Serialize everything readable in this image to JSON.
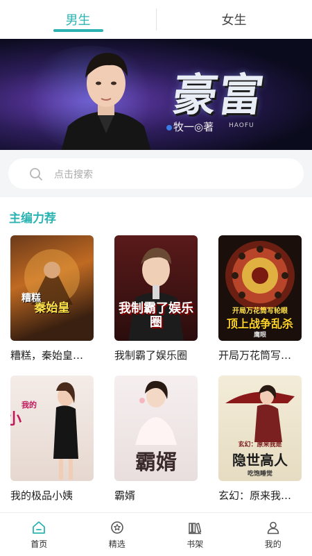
{
  "top_tabs": [
    {
      "label": "男生",
      "active": true
    },
    {
      "label": "女生",
      "active": false
    }
  ],
  "banner": {
    "title": "豪富",
    "author": "牧一◎著",
    "pinyin": "HAOFU"
  },
  "search": {
    "placeholder": "点击搜索"
  },
  "section": {
    "title": "主编力荐"
  },
  "books": [
    {
      "title": "糟糕，秦始皇…",
      "cover_text": "秦始皇",
      "cover_sub": "糟糕"
    },
    {
      "title": "我制霸了娱乐圈",
      "cover_text": "我制霸了娱乐圈"
    },
    {
      "title": "开局万花筒写…",
      "cover_text": "顶上战争乱杀",
      "cover_sub": "开局万花筒写轮眼",
      "cover_author": "鹰眼"
    },
    {
      "title": "我的极品小姨",
      "cover_text": "极品小姨",
      "cover_sub": "我的"
    },
    {
      "title": "霸婿",
      "cover_text": "霸婿"
    },
    {
      "title": "玄幻：原来我…",
      "cover_text": "隐世高人",
      "cover_sub": "玄幻：原来我是",
      "cover_author": "吃饱睡觉"
    }
  ],
  "bottom_nav": [
    {
      "label": "首页",
      "icon": "home-icon",
      "active": true
    },
    {
      "label": "精选",
      "icon": "star-badge-icon",
      "active": false
    },
    {
      "label": "书架",
      "icon": "bookshelf-icon",
      "active": false
    },
    {
      "label": "我的",
      "icon": "user-icon",
      "active": false
    }
  ],
  "colors": {
    "accent": "#2bb3b1",
    "search_bg": "#f4f5f7"
  }
}
